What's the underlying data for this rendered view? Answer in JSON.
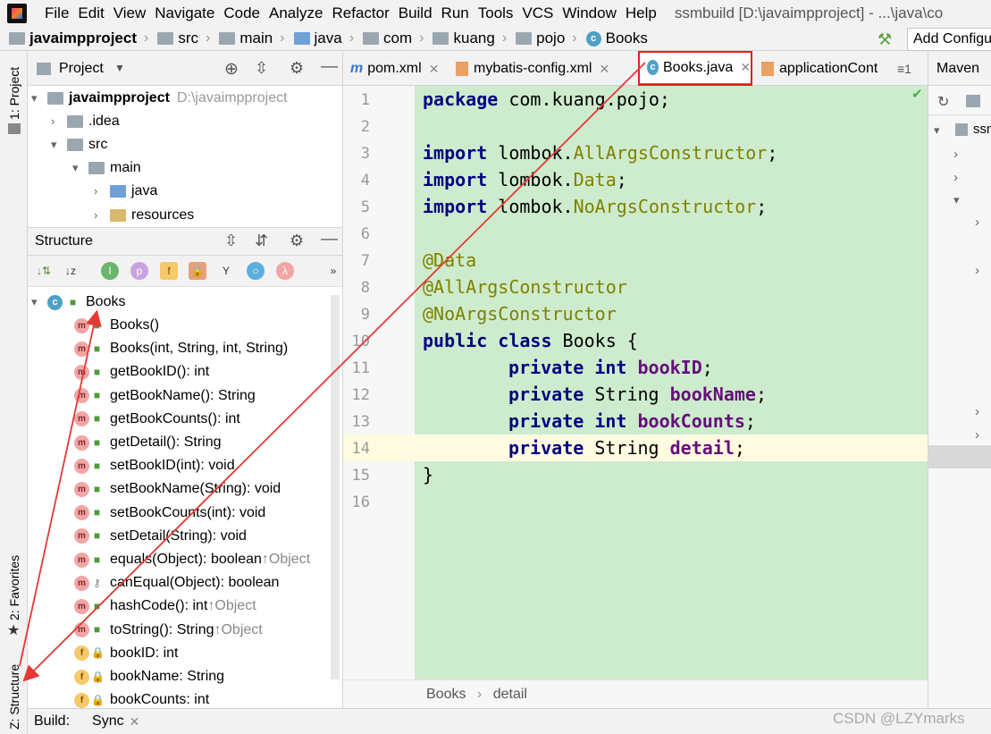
{
  "menubar": {
    "items": [
      "File",
      "Edit",
      "View",
      "Navigate",
      "Code",
      "Analyze",
      "Refactor",
      "Build",
      "Run",
      "Tools",
      "VCS",
      "Window",
      "Help"
    ],
    "title": "ssmbuild [D:\\javaimpproject] - ...\\java\\co"
  },
  "breadcrumb": {
    "items": [
      "javaimpproject",
      "src",
      "main",
      "java",
      "com",
      "kuang",
      "pojo",
      "Books"
    ],
    "add_config": "Add Configu"
  },
  "left_strip": {
    "project": "1: Project",
    "favorites": "2: Favorites",
    "structure": "Z: Structure"
  },
  "project": {
    "title": "Project",
    "tree": [
      {
        "label": "javaimpproject",
        "path": "D:\\javaimpproject"
      },
      {
        "label": ".idea"
      },
      {
        "label": "src"
      },
      {
        "label": "main"
      },
      {
        "label": "java"
      },
      {
        "label": "resources"
      }
    ]
  },
  "structure": {
    "title": "Structure",
    "root": "Books",
    "members": [
      {
        "kind": "m",
        "vis": "public",
        "label": "Books()",
        "inherit": ""
      },
      {
        "kind": "m",
        "vis": "public",
        "label": "Books(int, String, int, String)",
        "inherit": ""
      },
      {
        "kind": "m",
        "vis": "public",
        "label": "getBookID(): int",
        "inherit": ""
      },
      {
        "kind": "m",
        "vis": "public",
        "label": "getBookName(): String",
        "inherit": ""
      },
      {
        "kind": "m",
        "vis": "public",
        "label": "getBookCounts(): int",
        "inherit": ""
      },
      {
        "kind": "m",
        "vis": "public",
        "label": "getDetail(): String",
        "inherit": ""
      },
      {
        "kind": "m",
        "vis": "public",
        "label": "setBookID(int): void",
        "inherit": ""
      },
      {
        "kind": "m",
        "vis": "public",
        "label": "setBookName(String): void",
        "inherit": ""
      },
      {
        "kind": "m",
        "vis": "public",
        "label": "setBookCounts(int): void",
        "inherit": ""
      },
      {
        "kind": "m",
        "vis": "public",
        "label": "setDetail(String): void",
        "inherit": ""
      },
      {
        "kind": "m",
        "vis": "public",
        "label": "equals(Object): boolean",
        "inherit": "↑Object"
      },
      {
        "kind": "m",
        "vis": "protected",
        "label": "canEqual(Object): boolean",
        "inherit": ""
      },
      {
        "kind": "m",
        "vis": "public",
        "label": "hashCode(): int",
        "inherit": "↑Object"
      },
      {
        "kind": "m",
        "vis": "public",
        "label": "toString(): String",
        "inherit": "↑Object"
      },
      {
        "kind": "f",
        "vis": "private",
        "label": "bookID: int",
        "inherit": ""
      },
      {
        "kind": "f",
        "vis": "private",
        "label": "bookName: String",
        "inherit": ""
      },
      {
        "kind": "f",
        "vis": "private",
        "label": "bookCounts: int",
        "inherit": ""
      }
    ]
  },
  "editor": {
    "tabs": [
      "pom.xml",
      "mybatis-config.xml",
      "Books.java",
      "applicationCont"
    ],
    "tab_overflow": "≡1",
    "line_numbers": [
      "1",
      "2",
      "3",
      "4",
      "5",
      "6",
      "7",
      "8",
      "9",
      "10",
      "11",
      "12",
      "13",
      "14",
      "15",
      "16"
    ],
    "code": {
      "l1_kw": "package",
      "l1_rest": " com.kuang.pojo;",
      "l3_kw": "import",
      "l3_pre": " lombok.",
      "l3_an": "AllArgsConstructor",
      "l3_end": ";",
      "l4_kw": "import",
      "l4_pre": " lombok.",
      "l4_an": "Data",
      "l4_end": ";",
      "l5_kw": "import",
      "l5_pre": " lombok.",
      "l5_an": "NoArgsConstructor",
      "l5_end": ";",
      "l7": "@Data",
      "l8": "@AllArgsConstructor",
      "l9": "@NoArgsConstructor",
      "l10_kw": "public class",
      "l10_rest": " Books {",
      "l11_kw": "private int",
      "l11_var": "bookID",
      "l11_end": ";",
      "l12_kw": "private",
      "l12_type": " String ",
      "l12_var": "bookName",
      "l12_end": ";",
      "l13_kw": "private int",
      "l13_var": "bookCounts",
      "l13_end": ";",
      "l14_kw": "private",
      "l14_type": " String ",
      "l14_var": "detail",
      "l14_end": ";",
      "l15": "}"
    },
    "breadcrumb": [
      "Books",
      "detail"
    ]
  },
  "maven": {
    "title": "Maven",
    "root": "ssm"
  },
  "bottom": {
    "build": "Build:",
    "sync": "Sync"
  },
  "watermark": "CSDN @LZYmarks",
  "colors": {
    "accent": "#4083c9",
    "highlight_red": "#e02020",
    "code_bg": "#cdeccd"
  }
}
